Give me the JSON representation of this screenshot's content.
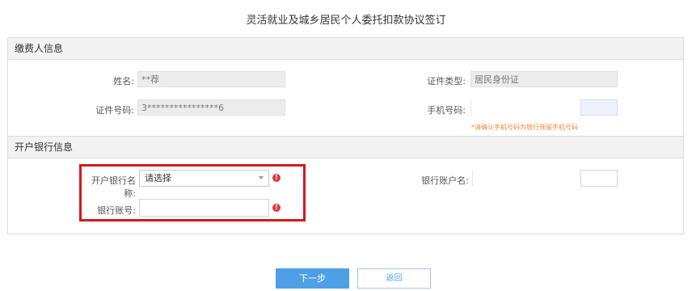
{
  "page": {
    "title": "灵活就业及城乡居民个人委托扣款协议签订"
  },
  "payer_section": {
    "header": "缴费人信息",
    "name_label": "姓名:",
    "name_value": "**荐",
    "id_type_label": "证件类型:",
    "id_type_value": "居民身份证",
    "id_number_label": "证件号码:",
    "id_number_value": "3****************6",
    "phone_label": "手机号码:",
    "phone_value": "",
    "phone_hint": "*请确认手机号码为银行预留手机号码"
  },
  "bank_section": {
    "header": "开户银行信息",
    "bank_name_label": "开户银行名称:",
    "bank_name_selected": "请选择",
    "account_name_label": "银行账户名:",
    "account_name_value": "",
    "account_number_label": "银行账号:",
    "account_number_value": "",
    "error_glyph": "!"
  },
  "actions": {
    "next_label": "下一步",
    "back_label": "返回"
  },
  "colors": {
    "primary": "#4d9fe6",
    "error": "#e0393e",
    "highlight": "#d4181d",
    "hint": "#f08a3c"
  }
}
